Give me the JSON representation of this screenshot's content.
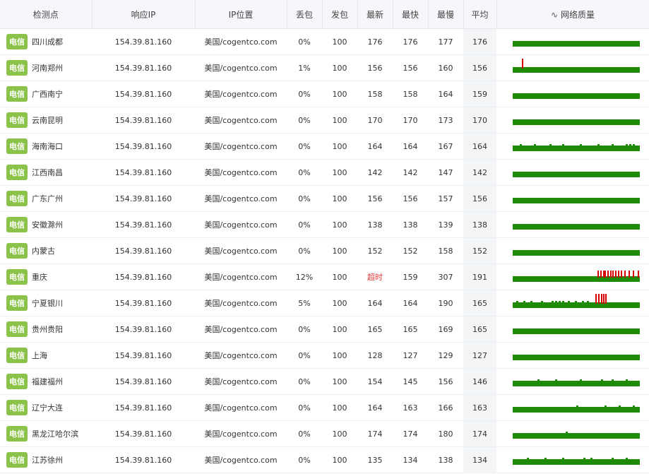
{
  "headers": {
    "node": "检测点",
    "ip": "响应IP",
    "location": "IP位置",
    "loss": "丢包",
    "sent": "发包",
    "latest": "最新",
    "fastest": "最快",
    "slowest": "最慢",
    "avg": "平均",
    "quality": "网络质量",
    "quality_icon": "∿"
  },
  "colors": {
    "isp_badge": "#8bc34a",
    "bar_ok": "#1e8a05",
    "bar_bad": "#d40000",
    "timeout": "#e53935"
  },
  "rows": [
    {
      "isp": "电信",
      "node": "四川成都",
      "ip": "154.39.81.160",
      "location": "美国/cogentco.com",
      "loss": "0%",
      "sent": "100",
      "latest": "176",
      "fastest": "176",
      "slowest": "177",
      "avg": "176"
    },
    {
      "isp": "电信",
      "node": "河南郑州",
      "ip": "154.39.81.160",
      "location": "美国/cogentco.com",
      "loss": "1%",
      "sent": "100",
      "latest": "156",
      "fastest": "156",
      "slowest": "160",
      "avg": "156"
    },
    {
      "isp": "电信",
      "node": "广西南宁",
      "ip": "154.39.81.160",
      "location": "美国/cogentco.com",
      "loss": "0%",
      "sent": "100",
      "latest": "158",
      "fastest": "158",
      "slowest": "164",
      "avg": "159"
    },
    {
      "isp": "电信",
      "node": "云南昆明",
      "ip": "154.39.81.160",
      "location": "美国/cogentco.com",
      "loss": "0%",
      "sent": "100",
      "latest": "170",
      "fastest": "170",
      "slowest": "173",
      "avg": "170"
    },
    {
      "isp": "电信",
      "node": "海南海口",
      "ip": "154.39.81.160",
      "location": "美国/cogentco.com",
      "loss": "0%",
      "sent": "100",
      "latest": "164",
      "fastest": "164",
      "slowest": "167",
      "avg": "164"
    },
    {
      "isp": "电信",
      "node": "江西南昌",
      "ip": "154.39.81.160",
      "location": "美国/cogentco.com",
      "loss": "0%",
      "sent": "100",
      "latest": "142",
      "fastest": "142",
      "slowest": "147",
      "avg": "142"
    },
    {
      "isp": "电信",
      "node": "广东广州",
      "ip": "154.39.81.160",
      "location": "美国/cogentco.com",
      "loss": "0%",
      "sent": "100",
      "latest": "156",
      "fastest": "156",
      "slowest": "157",
      "avg": "156"
    },
    {
      "isp": "电信",
      "node": "安徽滁州",
      "ip": "154.39.81.160",
      "location": "美国/cogentco.com",
      "loss": "0%",
      "sent": "100",
      "latest": "138",
      "fastest": "138",
      "slowest": "139",
      "avg": "138"
    },
    {
      "isp": "电信",
      "node": "内蒙古",
      "ip": "154.39.81.160",
      "location": "美国/cogentco.com",
      "loss": "0%",
      "sent": "100",
      "latest": "152",
      "fastest": "152",
      "slowest": "158",
      "avg": "152"
    },
    {
      "isp": "电信",
      "node": "重庆",
      "ip": "154.39.81.160",
      "location": "美国/cogentco.com",
      "loss": "12%",
      "sent": "100",
      "latest": "超时",
      "fastest": "159",
      "slowest": "307",
      "avg": "191",
      "timeout": true
    },
    {
      "isp": "电信",
      "node": "宁夏银川",
      "ip": "154.39.81.160",
      "location": "美国/cogentco.com",
      "loss": "5%",
      "sent": "100",
      "latest": "164",
      "fastest": "164",
      "slowest": "190",
      "avg": "165"
    },
    {
      "isp": "电信",
      "node": "贵州贵阳",
      "ip": "154.39.81.160",
      "location": "美国/cogentco.com",
      "loss": "0%",
      "sent": "100",
      "latest": "165",
      "fastest": "165",
      "slowest": "169",
      "avg": "165"
    },
    {
      "isp": "电信",
      "node": "上海",
      "ip": "154.39.81.160",
      "location": "美国/cogentco.com",
      "loss": "0%",
      "sent": "100",
      "latest": "128",
      "fastest": "127",
      "slowest": "129",
      "avg": "127"
    },
    {
      "isp": "电信",
      "node": "福建福州",
      "ip": "154.39.81.160",
      "location": "美国/cogentco.com",
      "loss": "0%",
      "sent": "100",
      "latest": "154",
      "fastest": "145",
      "slowest": "156",
      "avg": "146"
    },
    {
      "isp": "电信",
      "node": "辽宁大连",
      "ip": "154.39.81.160",
      "location": "美国/cogentco.com",
      "loss": "0%",
      "sent": "100",
      "latest": "164",
      "fastest": "163",
      "slowest": "166",
      "avg": "163"
    },
    {
      "isp": "电信",
      "node": "黑龙江哈尔滨",
      "ip": "154.39.81.160",
      "location": "美国/cogentco.com",
      "loss": "0%",
      "sent": "100",
      "latest": "174",
      "fastest": "174",
      "slowest": "180",
      "avg": "174"
    },
    {
      "isp": "电信",
      "node": "江苏徐州",
      "ip": "154.39.81.160",
      "location": "美国/cogentco.com",
      "loss": "0%",
      "sent": "100",
      "latest": "135",
      "fastest": "134",
      "slowest": "138",
      "avg": "134"
    }
  ]
}
